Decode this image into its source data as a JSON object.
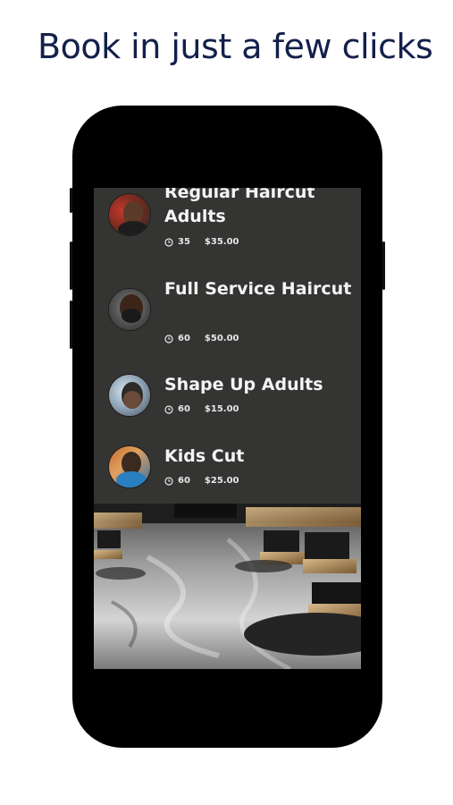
{
  "headline": "Book in just a few clicks",
  "services": [
    {
      "name": "Regular Haircut Adults",
      "duration": "35",
      "price": "$35.00",
      "avatar": "barber-avatar-1"
    },
    {
      "name": "Full Service Haircut",
      "duration": "60",
      "price": "$50.00",
      "avatar": "barber-avatar-2"
    },
    {
      "name": "Shape Up Adults",
      "duration": "60",
      "price": "$15.00",
      "avatar": "barber-avatar-3"
    },
    {
      "name": "Kids Cut",
      "duration": "60",
      "price": "$25.00",
      "avatar": "barber-avatar-4"
    }
  ],
  "colors": {
    "headline": "#13204a",
    "list_background": "#343533",
    "text": "#f4f4f4",
    "phone_frame": "#000000"
  },
  "icons": {
    "duration": "clock-icon"
  }
}
